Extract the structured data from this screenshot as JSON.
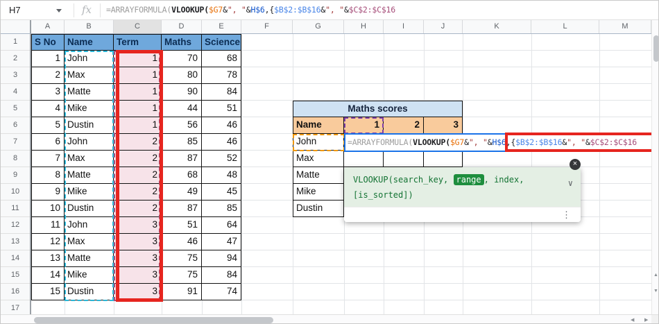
{
  "formula_bar": {
    "name_box": "H7",
    "fx": "fx"
  },
  "formula_segments": [
    {
      "text": "=ARRAYFORMULA(",
      "color": "#9e9e9e",
      "bold": false
    },
    {
      "text": "VLOOKUP(",
      "color": "#202124",
      "bold": true
    },
    {
      "text": "$G7",
      "color": "#e8710a",
      "bold": false
    },
    {
      "text": "&",
      "color": "#202124",
      "bold": false
    },
    {
      "text": "\", \"",
      "color": "#a33a3a",
      "bold": false
    },
    {
      "text": "&",
      "color": "#202124",
      "bold": false
    },
    {
      "text": "H$6",
      "color": "#1155cc",
      "bold": false
    },
    {
      "text": ",",
      "color": "#202124",
      "bold": false
    },
    {
      "text": "{",
      "color": "#202124",
      "bold": false
    },
    {
      "text": "$B$2:$B$16",
      "color": "#4a86e8",
      "bold": false
    },
    {
      "text": "&",
      "color": "#202124",
      "bold": false
    },
    {
      "text": "\", \"",
      "color": "#a33a3a",
      "bold": false
    },
    {
      "text": "&",
      "color": "#202124",
      "bold": false
    },
    {
      "text": "$C$2:$C$16",
      "color": "#a64d79",
      "bold": false
    }
  ],
  "grid": {
    "columns": [
      "A",
      "B",
      "C",
      "D",
      "E",
      "F",
      "G",
      "H",
      "I",
      "J",
      "K",
      "L",
      "M"
    ],
    "highlighted_column": "C",
    "rows": [
      "1",
      "2",
      "3",
      "4",
      "5",
      "6",
      "7",
      "8",
      "9",
      "10",
      "11",
      "12",
      "13",
      "14",
      "15",
      "16",
      "17"
    ]
  },
  "left_table": {
    "headers": [
      "S No",
      "Name",
      "Term",
      "Maths",
      "Science"
    ],
    "rows": [
      [
        "1",
        "John",
        "1",
        "70",
        "68"
      ],
      [
        "2",
        "Max",
        "1",
        "80",
        "78"
      ],
      [
        "3",
        "Matte",
        "1",
        "90",
        "84"
      ],
      [
        "4",
        "Mike",
        "1",
        "44",
        "51"
      ],
      [
        "5",
        "Dustin",
        "1",
        "56",
        "46"
      ],
      [
        "6",
        "John",
        "2",
        "85",
        "46"
      ],
      [
        "7",
        "Max",
        "2",
        "87",
        "52"
      ],
      [
        "8",
        "Matte",
        "2",
        "68",
        "48"
      ],
      [
        "9",
        "Mike",
        "2",
        "49",
        "45"
      ],
      [
        "10",
        "Dustin",
        "2",
        "87",
        "85"
      ],
      [
        "11",
        "John",
        "3",
        "51",
        "64"
      ],
      [
        "12",
        "Max",
        "3",
        "46",
        "47"
      ],
      [
        "13",
        "Matte",
        "3",
        "75",
        "94"
      ],
      [
        "14",
        "Mike",
        "3",
        "75",
        "84"
      ],
      [
        "15",
        "Dustin",
        "3",
        "91",
        "74"
      ]
    ]
  },
  "right_table": {
    "title": "Maths scores",
    "headers": [
      "Name",
      "1",
      "2",
      "3"
    ],
    "names": [
      "John",
      "Max",
      "Matte",
      "Mike",
      "Dustin"
    ]
  },
  "tooltip": {
    "part1": "VLOOKUP(search_key, ",
    "highlight": "range",
    "part2": ", index,",
    "line2": "[is_sorted])",
    "close_glyph": "×",
    "chevron_glyph": "∨",
    "kebab_glyph": "⋮"
  },
  "colors": {
    "header-blue": "#6fa8dc",
    "title-blue": "#cfe2f3",
    "peach": "#f9cb9c",
    "term-pink": "#f7e3e9",
    "annotation-red": "#e6251f",
    "editor-blue": "#1a73e8",
    "ants-cyan": "#2bb8d8",
    "ants-orange": "#f29900",
    "ants-purple": "#7e3fa8",
    "tooltip-green-bg": "#e4efe4",
    "tooltip-green": "#137333",
    "chip-green": "#1e8e3e"
  }
}
